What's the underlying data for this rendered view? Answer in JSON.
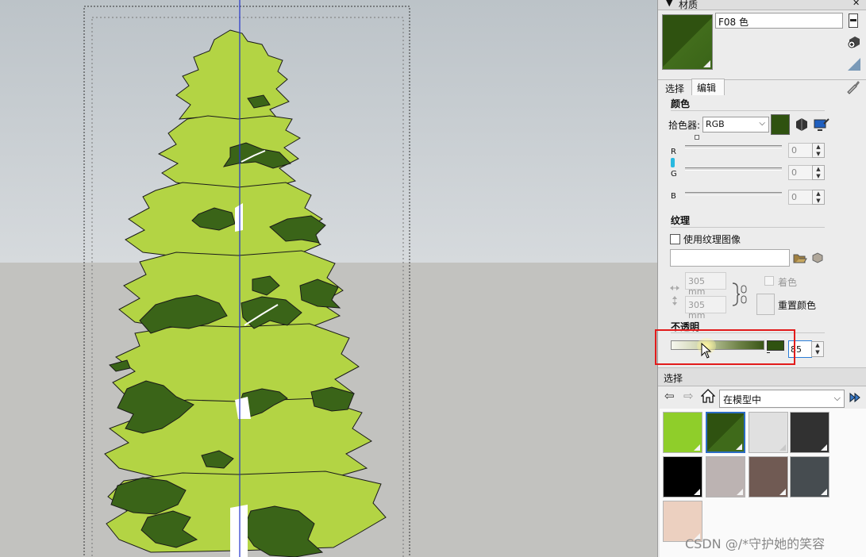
{
  "panel": {
    "materials_title": "材质",
    "material_name": "F08 色",
    "tabs": [
      {
        "label": "选择"
      },
      {
        "label": "编辑"
      }
    ],
    "color_section": "颜色",
    "picker_label": "拾色器:",
    "picker_value": "RGB",
    "rgb": [
      {
        "label": "R",
        "value": "0"
      },
      {
        "label": "G",
        "value": "0"
      },
      {
        "label": "B",
        "value": "0"
      }
    ],
    "texture_section": "纹理",
    "use_texture_label": "使用纹理图像",
    "width_value": "305 mm",
    "height_value": "305 mm",
    "colorize_label": "着色",
    "reset_color_label": "重置颜色",
    "opacity_section": "不透明",
    "opacity_value": "85",
    "select_section": "选择",
    "in_model_value": "在模型中",
    "swatches": [
      {
        "color": "#8fce2a"
      },
      {
        "color": "#2f5210",
        "selected": true
      },
      {
        "color": "#e0e0e0"
      },
      {
        "color": "#313131"
      },
      {
        "color": "#000000"
      },
      {
        "color": "#bcb3b2"
      },
      {
        "color": "#705a53"
      },
      {
        "color": "#464c50"
      },
      {
        "color": "#ecd0c0"
      }
    ]
  },
  "watermark": "CSDN @/*守护她的笑容",
  "colors": {
    "foliage_light": "#b3d444",
    "foliage_dark": "#3a6418",
    "current_material": "#2f5210",
    "highlight_box": "#e21b1b"
  }
}
